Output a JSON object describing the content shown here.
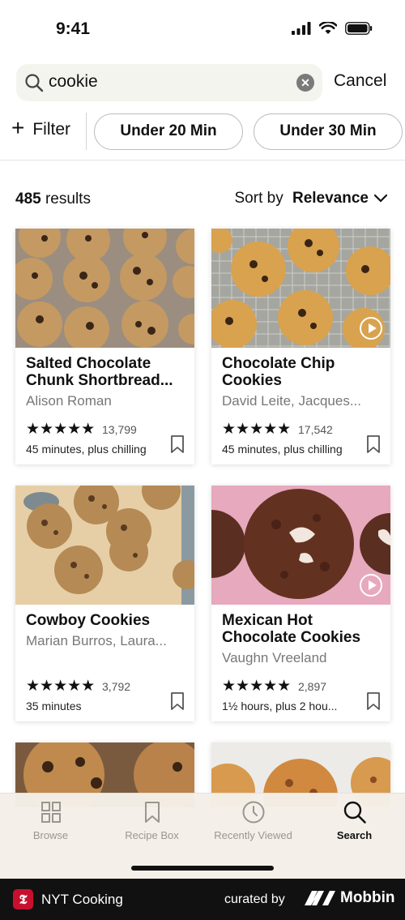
{
  "status_bar": {
    "time": "9:41"
  },
  "search": {
    "query": "cookie",
    "cancel_label": "Cancel"
  },
  "filters": {
    "filter_label": "Filter",
    "chips": [
      "Under 20 Min",
      "Under 30 Min"
    ]
  },
  "results": {
    "count": "485",
    "count_suffix": " results",
    "sort_prefix": "Sort by ",
    "sort_value": "Relevance"
  },
  "cards": [
    {
      "title": "Salted Chocolate Chunk Shortbread...",
      "author": "Alison Roman",
      "stars": "★★★★★",
      "rating_count": "13,799",
      "time": "45 minutes, plus chilling",
      "has_video": false
    },
    {
      "title": "Chocolate Chip Cookies",
      "author": "David Leite, Jacques...",
      "stars": "★★★★★",
      "rating_count": "17,542",
      "time": "45 minutes, plus chilling",
      "has_video": true
    },
    {
      "title": "Cowboy Cookies",
      "author": "Marian Burros, Laura...",
      "stars": "★★★★★",
      "rating_count": "3,792",
      "time": "35 minutes",
      "has_video": false
    },
    {
      "title": "Mexican Hot Chocolate Cookies",
      "author": "Vaughn Vreeland",
      "stars": "★★★★★",
      "rating_count": "2,897",
      "time": "1½ hours, plus 2 hou...",
      "has_video": true
    }
  ],
  "tabs": [
    {
      "label": "Browse",
      "icon": "grid-icon",
      "active": false
    },
    {
      "label": "Recipe Box",
      "icon": "bookmark-icon",
      "active": false
    },
    {
      "label": "Recently Viewed",
      "icon": "clock-icon",
      "active": false
    },
    {
      "label": "Search",
      "icon": "search-icon",
      "active": true
    }
  ],
  "footer": {
    "app_name": "NYT Cooking",
    "logo_letter": "𝕿",
    "curated_by": "curated by",
    "brand": "Mobbin"
  },
  "colors": {
    "accent": "#c8102e",
    "tab_bar": "#f4efe8",
    "footer": "#111111"
  }
}
